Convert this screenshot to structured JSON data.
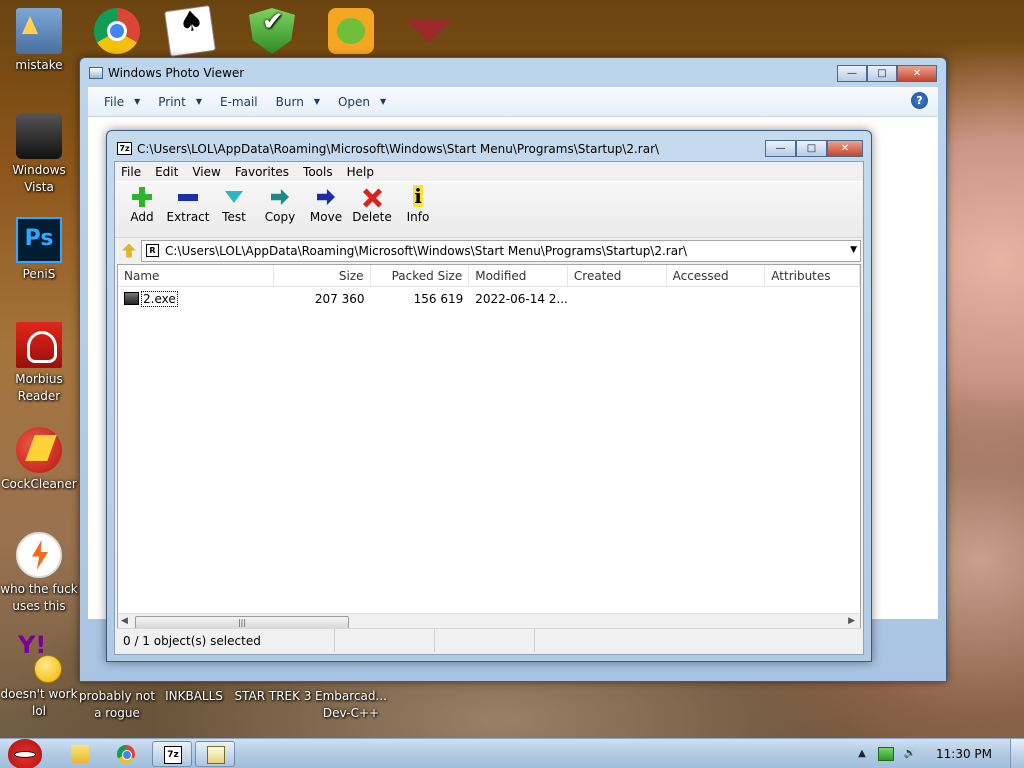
{
  "desktop": {
    "icons_top": [
      {
        "name": "mistake-icon",
        "label": "mistake"
      },
      {
        "name": "chrome-icon",
        "label": ""
      },
      {
        "name": "solitaire-icon",
        "label": ""
      },
      {
        "name": "shield-icon",
        "label": ""
      },
      {
        "name": "bad-piggies-icon",
        "label": ""
      },
      {
        "name": "red-app-icon",
        "label": ""
      }
    ],
    "icons_left": [
      {
        "name": "recycle-bin-icon",
        "label": "Windows Vista"
      },
      {
        "name": "photoshop-icon",
        "label": "PeniS",
        "glyph": "Ps"
      },
      {
        "name": "pdf-reader-icon",
        "label": "Morbius Reader"
      },
      {
        "name": "ccleaner-icon",
        "label": "CockCleaner"
      },
      {
        "name": "bolt-app-icon",
        "label": "who the fuck uses this"
      },
      {
        "name": "yahoo-messenger-icon",
        "label": "doesn't work lol"
      }
    ],
    "icons_bottom": [
      {
        "name": "rogue-icon",
        "label": "probably not a rogue"
      },
      {
        "name": "inkballs-icon",
        "label": "INKBALLS"
      },
      {
        "name": "star-trek-icon",
        "label": "STAR TREK 3"
      },
      {
        "name": "devcpp-icon",
        "label": "Embarcad... Dev-C++"
      }
    ]
  },
  "photo_viewer": {
    "title": "Windows Photo Viewer",
    "menu": [
      {
        "label": "File",
        "dropdown": true
      },
      {
        "label": "Print",
        "dropdown": true
      },
      {
        "label": "E-mail",
        "dropdown": false
      },
      {
        "label": "Burn",
        "dropdown": true
      },
      {
        "label": "Open",
        "dropdown": true
      }
    ],
    "help_glyph": "?"
  },
  "sevenzip": {
    "title": "C:\\Users\\LOL\\AppData\\Roaming\\Microsoft\\Windows\\Start Menu\\Programs\\Startup\\2.rar\\",
    "app_glyph": "7z",
    "menu": [
      "File",
      "Edit",
      "View",
      "Favorites",
      "Tools",
      "Help"
    ],
    "toolbar": [
      {
        "label": "Add",
        "icon": "add-icon"
      },
      {
        "label": "Extract",
        "icon": "extract-icon"
      },
      {
        "label": "Test",
        "icon": "test-icon"
      },
      {
        "label": "Copy",
        "icon": "copy-icon"
      },
      {
        "label": "Move",
        "icon": "move-icon"
      },
      {
        "label": "Delete",
        "icon": "delete-icon"
      },
      {
        "label": "Info",
        "icon": "info-icon"
      }
    ],
    "address": "C:\\Users\\LOL\\AppData\\Roaming\\Microsoft\\Windows\\Start Menu\\Programs\\Startup\\2.rar\\",
    "columns": [
      "Name",
      "Size",
      "Packed Size",
      "Modified",
      "Created",
      "Accessed",
      "Attributes"
    ],
    "rows": [
      {
        "name": "2.exe",
        "size": "207 360",
        "packed_size": "156 619",
        "modified": "2022-06-14 2...",
        "created": "",
        "accessed": "",
        "attributes": ""
      }
    ],
    "status": "0 / 1 object(s) selected"
  },
  "taskbar": {
    "clock": "11:30 PM",
    "apps": [
      {
        "name": "explorer-taskbar-icon"
      },
      {
        "name": "chrome-taskbar-icon"
      },
      {
        "name": "sevenzip-taskbar-icon",
        "glyph": "7z"
      },
      {
        "name": "photo-viewer-taskbar-icon"
      }
    ]
  },
  "colors": {
    "window_frame": "#b3cae4",
    "close_button": "#c34730",
    "taskbar": "#b3cbe4"
  }
}
